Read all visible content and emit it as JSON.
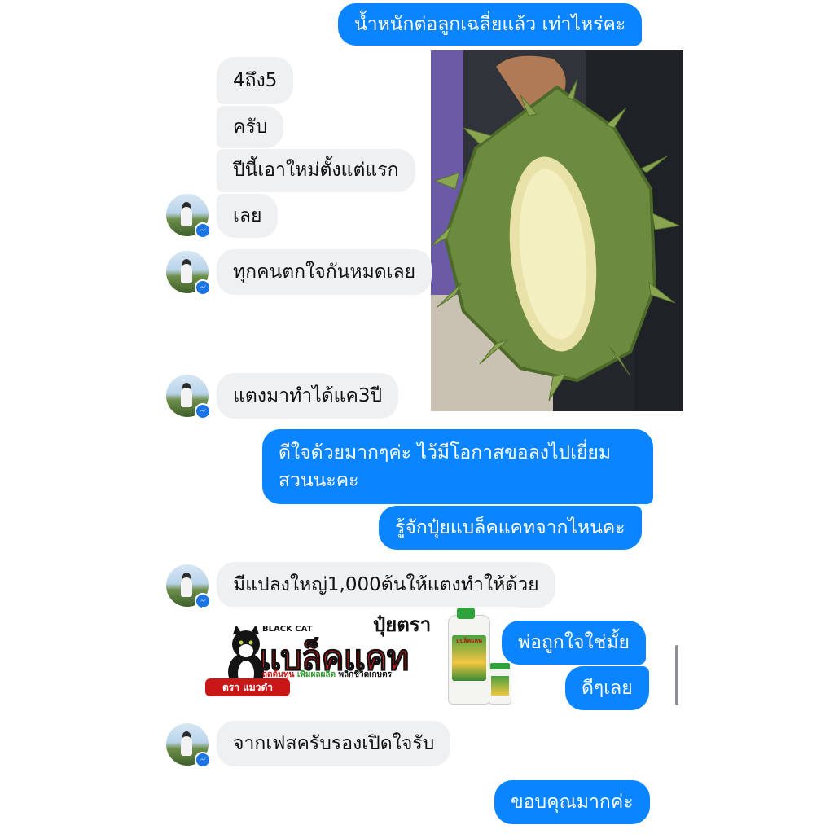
{
  "messages": {
    "m1": "น้ำหนักต่อลูกเฉลี่ยแล้ว เท่าไหร่คะ",
    "m2": "4ถึง5",
    "m3": "ครับ",
    "m4": "ปีนี้เอาใหม่ตั้งแต่แรก",
    "m5": "เลย",
    "m6": "ทุกคนตกใจกันหมดเลย",
    "m7": "แตงมาทำได้แค3ปี",
    "m8_line1": "ดีใจด้วยมากๆค่ะ  ไว้มีโอกาสขอลงไปเยี่ยม",
    "m8_line2": "สวนนะคะ",
    "m9": "รู้จักปุ๋ยแบล็คแคทจากไหนคะ",
    "m10": "มีแปลงใหญ่1,000ต้นให้แตงทำให้ด้วย",
    "m11": "พ่อถูกใจใช่มั้ย",
    "m12": "ดีๆเลย",
    "m13": "จากเฟสครับรองเปิดใจรับ",
    "m14": "ขอบคุณมากค่ะ"
  },
  "ad": {
    "title_top": "ปุ๋ยตรา",
    "brand_en": "BLACK CAT",
    "brand_th": "แบล็คแคท",
    "slogan_a": "ลดต้นทุน",
    "slogan_b": "เพิ่มผลผลิต",
    "slogan_c": "พลิกชีวิตเกษตร",
    "ribbon": "ตรา แมวดำ",
    "bottle_label": "แบล็คแคท"
  },
  "colors": {
    "outgoing_bubble": "#0a84ff",
    "incoming_bubble": "#eff0f2",
    "messenger_badge": "#1b74e4",
    "brand_red": "#d01515"
  },
  "icons": {
    "avatar_badge": "messenger-icon"
  }
}
